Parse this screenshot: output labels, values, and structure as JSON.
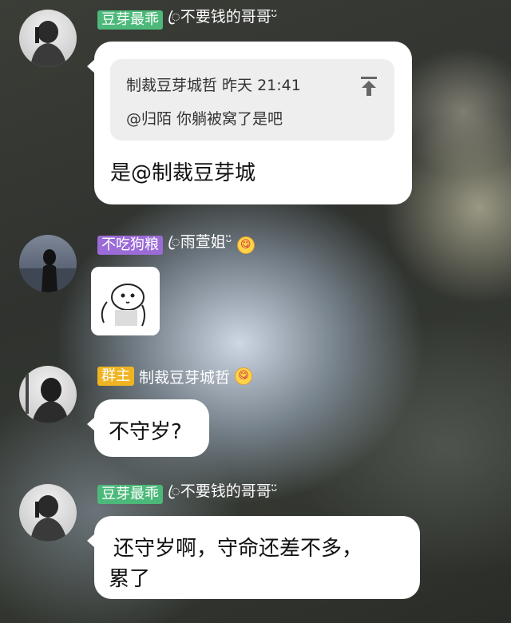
{
  "messages": [
    {
      "badge": "豆芽最乖",
      "nickname": "ꦿ不要钱的哥哥ᵕ̈",
      "quote": {
        "author_time": "制裁豆芽城哲 昨天 21:41",
        "text": "@归陌 你躺被窝了是吧"
      },
      "text": "是@制裁豆芽城"
    },
    {
      "badge": "不吃狗粮",
      "nickname": "ꦿ雨萱姐ᵕ̈",
      "emoji": "😋"
    },
    {
      "badge": "群主",
      "nickname": "制裁豆芽城哲",
      "emoji": "😋",
      "text": "不守岁?"
    },
    {
      "badge": "豆芽最乖",
      "nickname": "ꦿ不要钱的哥哥ᵕ̈",
      "text_line1": "还守岁啊，守命还差不多，",
      "text_line2": "累了"
    }
  ],
  "icons": {
    "quote": "scroll-to-top-icon",
    "sticker": "cartoon-sticker"
  },
  "colors": {
    "badge_green": "#4cb97a",
    "badge_purple": "#9b6bd8",
    "badge_yellow": "#f0b422"
  }
}
